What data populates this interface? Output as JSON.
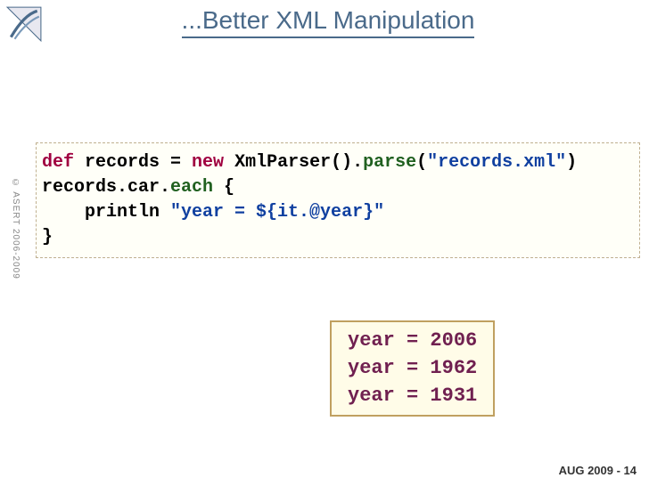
{
  "title": "...Better XML Manipulation",
  "copyright": "© ASERT 2006-2009",
  "code": {
    "l1_kw1": "def",
    "l1_p1": " records = ",
    "l1_kw2": "new",
    "l1_p2": " XmlParser().",
    "l1_m1": "parse",
    "l1_p3": "(",
    "l1_s1": "\"records.xml\"",
    "l1_p4": ")",
    "l2_p1": "records.car.",
    "l2_m1": "each",
    "l2_p2": " {",
    "l3_p1": "    println ",
    "l3_s1": "\"year = ${it.@year}\"",
    "l4_p1": "}"
  },
  "output": {
    "line1": "year = 2006",
    "line2": "year = 1962",
    "line3": "year = 1931"
  },
  "footer": "AUG 2009 - 14"
}
